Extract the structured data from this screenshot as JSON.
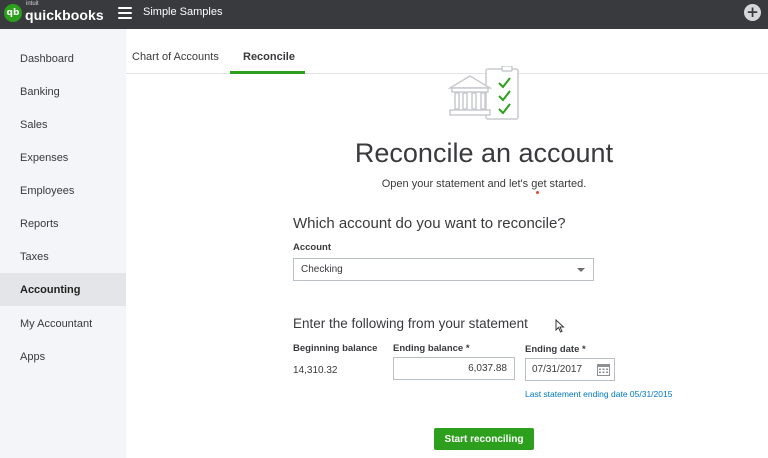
{
  "header": {
    "logo_badge": "qb",
    "logo_small": "intuit",
    "logo_main": "quickbooks",
    "company_name": "Simple Samples",
    "plus_symbol": "+"
  },
  "sidebar": {
    "items": [
      {
        "label": "Dashboard",
        "active": false
      },
      {
        "label": "Banking",
        "active": false
      },
      {
        "label": "Sales",
        "active": false
      },
      {
        "label": "Expenses",
        "active": false
      },
      {
        "label": "Employees",
        "active": false
      },
      {
        "label": "Reports",
        "active": false
      },
      {
        "label": "Taxes",
        "active": false
      },
      {
        "label": "Accounting",
        "active": true
      },
      {
        "label": "My Accountant",
        "active": false
      },
      {
        "label": "Apps",
        "active": false
      }
    ]
  },
  "tabs": [
    {
      "label": "Chart of Accounts",
      "active": false
    },
    {
      "label": "Reconcile",
      "active": true
    }
  ],
  "main": {
    "title": "Reconcile an account",
    "subtitle": "Open your statement and let's get started.",
    "account_question": "Which account do you want to reconcile?",
    "account_label": "Account",
    "account_value": "Checking",
    "statement_heading": "Enter the following from your statement",
    "beginning_balance_label": "Beginning balance",
    "beginning_balance_value": "14,310.32",
    "ending_balance_label": "Ending balance *",
    "ending_balance_value": "6,037.88",
    "ending_date_label": "Ending date *",
    "ending_date_value": "07/31/2017",
    "last_statement_text": "Last statement ending date 05/31/2015",
    "start_button": "Start reconciling"
  },
  "colors": {
    "topbar": "#393a3d",
    "brand_green": "#2ca01c",
    "link_blue": "#0077c5",
    "sidebar_bg": "#f4f5f8"
  },
  "icons": [
    "hamburger-menu-icon",
    "plus-icon",
    "bank-checklist-icon",
    "dropdown-caret-icon",
    "calendar-icon",
    "mouse-cursor-icon"
  ]
}
